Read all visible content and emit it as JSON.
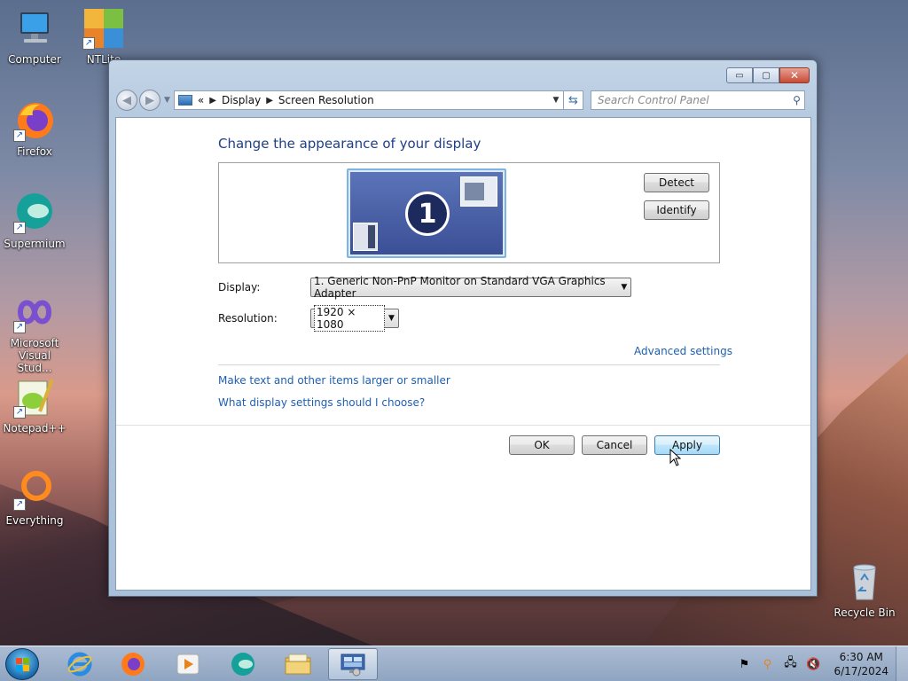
{
  "desktop": {
    "icons": [
      {
        "label": "Computer",
        "icon": "computer-icon"
      },
      {
        "label": "NTLite",
        "icon": "ntlite-icon"
      },
      {
        "label": "Firefox",
        "icon": "firefox-icon"
      },
      {
        "label": "Supermium",
        "icon": "supermium-icon"
      },
      {
        "label": "Microsoft Visual Stud...",
        "icon": "visual-studio-icon"
      },
      {
        "label": "Notepad++",
        "icon": "notepadpp-icon"
      },
      {
        "label": "Everything",
        "icon": "everything-icon"
      },
      {
        "label": "Recycle Bin",
        "icon": "recycle-bin-icon"
      }
    ]
  },
  "window": {
    "caption": {
      "minimize": "▭",
      "maximize": "▢",
      "close": "✕"
    },
    "address": {
      "chevron": "«",
      "crumbs": [
        "Display",
        "Screen Resolution"
      ]
    },
    "search": {
      "placeholder": "Search Control Panel"
    },
    "heading": "Change the appearance of your display",
    "monitor_number": "1",
    "detect_label": "Detect",
    "identify_label": "Identify",
    "display_label": "Display:",
    "display_value": "1. Generic Non-PnP Monitor on Standard VGA Graphics Adapter",
    "resolution_label": "Resolution:",
    "resolution_value": "1920 × 1080",
    "advanced_link": "Advanced settings",
    "link_text_size": "Make text and other items larger or smaller",
    "link_which_settings": "What display settings should I choose?",
    "ok_label": "OK",
    "cancel_label": "Cancel",
    "apply_label": "Apply"
  },
  "taskbar": {
    "items": [
      "internet-explorer-icon",
      "firefox-icon",
      "media-player-icon",
      "supermium-icon",
      "file-explorer-icon",
      "display-control-panel-icon"
    ],
    "clock_time": "6:30 AM",
    "clock_date": "6/17/2024"
  },
  "colors": {
    "heading": "#1e3f86",
    "link": "#1f5fb0",
    "monitor": "#3b4f96"
  }
}
